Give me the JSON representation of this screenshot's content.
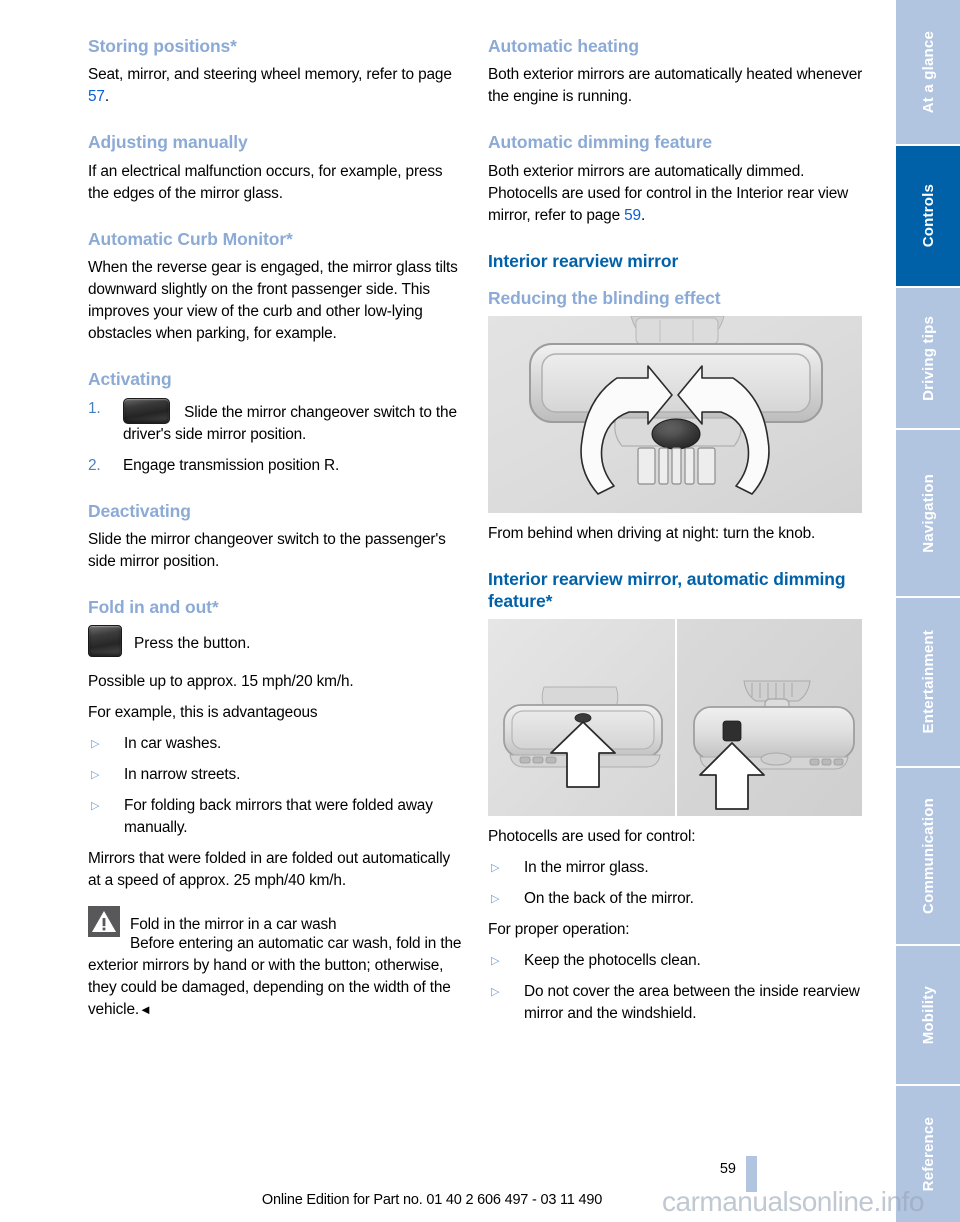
{
  "left_column": {
    "heading_storing": "Storing positions*",
    "storing_text_a": "Seat, mirror, and steering wheel memory, refer to page ",
    "storing_pageref": "57",
    "storing_text_b": ".",
    "heading_adjusting": "Adjusting manually",
    "adjusting_text": "If an electrical malfunction occurs, for example, press the edges of the mirror glass.",
    "heading_curb": "Automatic Curb Monitor*",
    "curb_text": "When the reverse gear is engaged, the mirror glass tilts downward slightly on the front passenger side. This improves your view of the curb and other low-lying obstacles when parking, for example.",
    "heading_activating": "Activating",
    "steps": [
      {
        "num": "1.",
        "icon": "mirror-changeover-switch-icon",
        "text": "Slide the mirror changeover switch to the driver's side mirror position."
      },
      {
        "num": "2.",
        "icon": "",
        "text": "Engage transmission position R."
      }
    ],
    "heading_deactivating": "Deactivating",
    "deactivating_text": "Slide the mirror changeover switch to the passenger's side mirror position.",
    "heading_fold": "Fold in and out*",
    "fold_button_icon": "fold-mirror-button-icon",
    "fold_button_text": "Press the button.",
    "fold_speed_text": "Possible up to approx. 15 mph/20 km/h.",
    "fold_intro_text": "For example, this is advantageous",
    "fold_bullets": [
      "In car washes.",
      "In narrow streets.",
      "For folding back mirrors that were folded away manually."
    ],
    "fold_auto_text": "Mirrors that were folded in are folded out automatically at a speed of approx. 25 mph/40 km/h.",
    "warning": {
      "icon": "warning-triangle-icon",
      "title": "Fold in the mirror in a car wash",
      "body": "Before entering an automatic car wash, fold in the exterior mirrors by hand or with the button; otherwise, they could be damaged, depending on the width of the vehicle.",
      "endmark": "◄"
    }
  },
  "right_column": {
    "heading_heating": "Automatic heating",
    "heating_text": "Both exterior mirrors are automatically heated whenever the engine is running.",
    "heading_dimming": "Automatic dimming feature",
    "dimming_text_a": "Both exterior mirrors are automatically dimmed. Photocells are used for control in the Interior rear view mirror, refer to page ",
    "dimming_pageref": "59",
    "dimming_text_b": ".",
    "heading_interior": "Interior rearview mirror",
    "heading_reducing": "Reducing the blinding effect",
    "figure_1": "interior-rearview-mirror-knob-illustration",
    "figure_1_caption": "From behind when driving at night: turn the knob.",
    "heading_interior_auto": "Interior rearview mirror, automatic dimming feature*",
    "figure_2": "photocell-locations-illustration",
    "photocells_intro": "Photocells are used for control:",
    "photocells_bullets": [
      "In the mirror glass.",
      "On the back of the mirror."
    ],
    "operation_intro": "For proper operation:",
    "operation_bullets": [
      "Keep the photocells clean.",
      "Do not cover the area between the inside rearview mirror and the windshield."
    ]
  },
  "sidebar": {
    "tabs": [
      {
        "label": "At a glance",
        "active": false
      },
      {
        "label": "Controls",
        "active": true
      },
      {
        "label": "Driving tips",
        "active": false
      },
      {
        "label": "Navigation",
        "active": false
      },
      {
        "label": "Entertainment",
        "active": false
      },
      {
        "label": "Communication",
        "active": false
      },
      {
        "label": "Mobility",
        "active": false
      },
      {
        "label": "Reference",
        "active": false
      }
    ],
    "active_color": "#0061A8",
    "inactive_color": "#B1C4E0"
  },
  "footer": {
    "page_number": "59",
    "edition_line": "Online Edition for Part no. 01 40 2 606 497 - 03 11 490",
    "watermark": "carmanualsonline.info"
  },
  "colors": {
    "heading_light_blue": "#8CAAD6",
    "heading_dark_blue": "#0061A8",
    "page_reference_blue": "#0B5FD0",
    "bullet_blue": "#6E9AD4"
  }
}
